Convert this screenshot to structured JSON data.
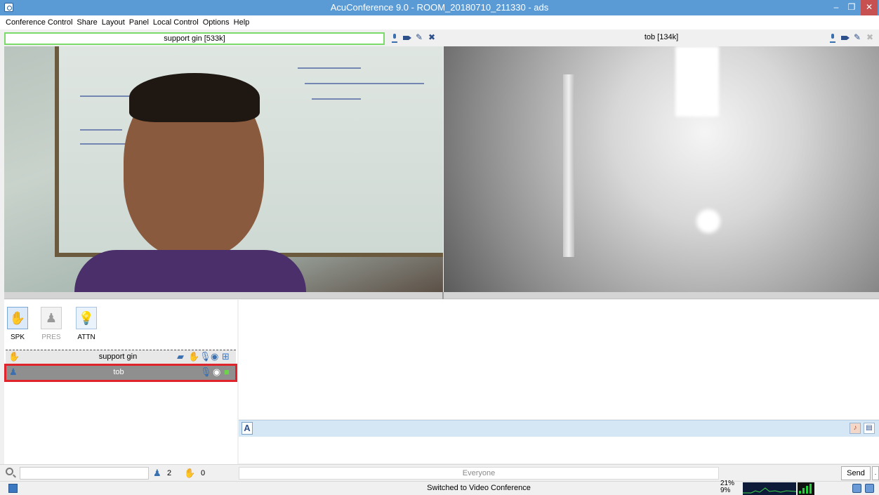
{
  "window": {
    "title": "AcuConference 9.0 - ROOM_20180710_211330 - ads",
    "minimize": "–",
    "maximize": "❐",
    "close": "✕"
  },
  "menu": [
    "Conference Control",
    "Share",
    "Layout",
    "Panel",
    "Local Control",
    "Options",
    "Help"
  ],
  "videos": {
    "left": {
      "name": "support gin [533k]"
    },
    "right": {
      "name": "tob [134k]"
    }
  },
  "tools": {
    "spk": "SPK",
    "pres": "PRES",
    "attn": "ATTN"
  },
  "participants": [
    {
      "name": "support gin"
    },
    {
      "name": "tob"
    }
  ],
  "chat": {
    "font_button": "A",
    "recipient": "Everyone",
    "send": "Send",
    "send_more": "."
  },
  "counts": {
    "participants": "2",
    "hands": "0"
  },
  "search": {
    "placeholder": ""
  },
  "status": {
    "message": "Switched to Video Conference",
    "cpu_top": "21%",
    "cpu_bottom": "9%"
  }
}
